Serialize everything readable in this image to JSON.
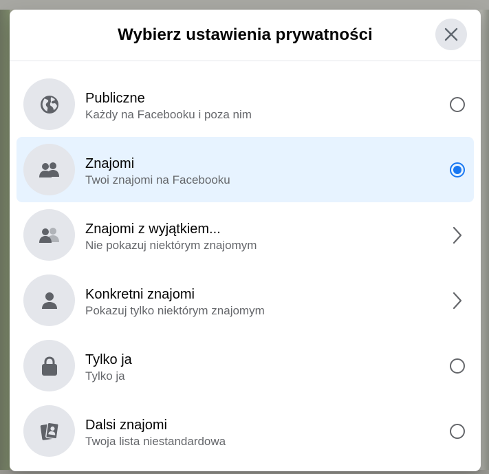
{
  "dialog": {
    "title": "Wybierz ustawienia prywatności",
    "close_icon": "close-icon"
  },
  "colors": {
    "accent": "#1877f2",
    "selected_bg": "#e7f3ff",
    "icon_bg": "#e4e6eb",
    "text_primary": "#050505",
    "text_secondary": "#65676b"
  },
  "options": [
    {
      "title": "Publiczne",
      "subtitle": "Każdy na Facebooku i poza nim",
      "icon": "globe-icon",
      "control": "radio",
      "selected": false
    },
    {
      "title": "Znajomi",
      "subtitle": "Twoi znajomi na Facebooku",
      "icon": "friends-icon",
      "control": "radio",
      "selected": true
    },
    {
      "title": "Znajomi z wyjątkiem...",
      "subtitle": "Nie pokazuj niektórym znajomym",
      "icon": "friends-except-icon",
      "control": "chevron",
      "selected": false
    },
    {
      "title": "Konkretni znajomi",
      "subtitle": "Pokazuj tylko niektórym znajomym",
      "icon": "person-icon",
      "control": "chevron",
      "selected": false
    },
    {
      "title": "Tylko ja",
      "subtitle": "Tylko ja",
      "icon": "lock-icon",
      "control": "radio",
      "selected": false
    },
    {
      "title": "Dalsi znajomi",
      "subtitle": "Twoja lista niestandardowa",
      "icon": "custom-list-icon",
      "control": "radio",
      "selected": false
    }
  ]
}
